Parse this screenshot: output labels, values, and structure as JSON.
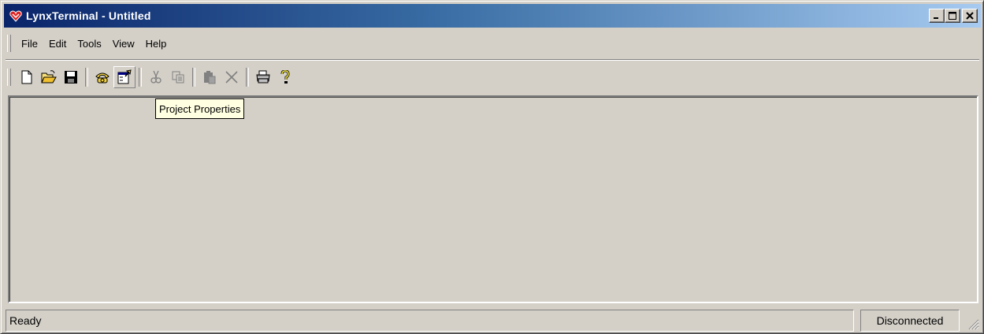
{
  "window": {
    "title": "LynxTerminal - Untitled",
    "title_icon": "lynx-logo-icon",
    "buttons": [
      "minimize-icon",
      "maximize-icon",
      "close-icon"
    ]
  },
  "menu": {
    "items": [
      {
        "label": "File"
      },
      {
        "label": "Edit"
      },
      {
        "label": "Tools"
      },
      {
        "label": "View"
      },
      {
        "label": "Help"
      }
    ]
  },
  "toolbar": {
    "buttons": [
      {
        "icon": "new-document-icon",
        "enabled": true
      },
      {
        "icon": "open-folder-icon",
        "enabled": true
      },
      {
        "icon": "save-disk-icon",
        "enabled": true
      },
      {
        "icon": "phone-connect-icon",
        "enabled": true
      },
      {
        "icon": "project-properties-icon",
        "enabled": true,
        "hovered": true
      },
      {
        "icon": "cut-icon",
        "enabled": false
      },
      {
        "icon": "copy-icon",
        "enabled": false
      },
      {
        "icon": "paste-icon",
        "enabled": false
      },
      {
        "icon": "delete-icon",
        "enabled": false
      },
      {
        "icon": "print-icon",
        "enabled": true
      },
      {
        "icon": "help-icon",
        "enabled": true
      }
    ]
  },
  "tooltip": {
    "text": "Project Properties"
  },
  "status": {
    "left": "Ready",
    "right": "Disconnected"
  },
  "colors": {
    "title_gradient_start": "#0a246a",
    "title_gradient_end": "#a6caf0",
    "face": "#d4d0c8",
    "tooltip_bg": "#ffffe1"
  }
}
